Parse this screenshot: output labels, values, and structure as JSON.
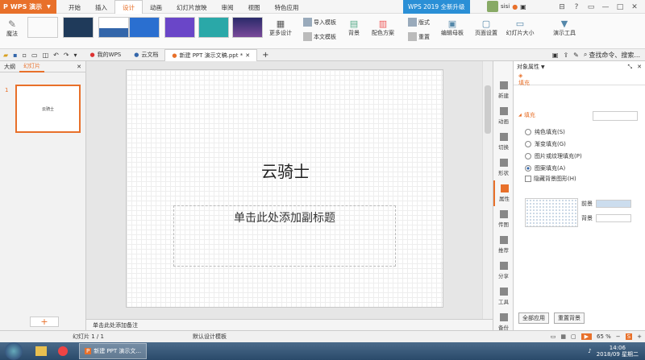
{
  "app": {
    "name": "WPS 演示",
    "upgrade": "WPS 2019 全新升级",
    "user": "sisi"
  },
  "menu_tabs": [
    "开始",
    "插入",
    "设计",
    "动画",
    "幻灯片放映",
    "审阅",
    "视图",
    "特色应用"
  ],
  "active_menu": "设计",
  "ribbon": {
    "magic": "魔法",
    "more_design": "更多设计",
    "import_template": "导入模板",
    "this_template": "本文模板",
    "background": "背景",
    "color_scheme": "配色方案",
    "layout": "版式",
    "rearrange": "重置",
    "edit_master": "编辑母板",
    "page_setup": "页面设置",
    "slide_size": "幻灯片大小",
    "presenter_tools": "演示工具"
  },
  "search_placeholder": "查找命令、搜索...",
  "doc_tabs": [
    {
      "label": "我的WPS",
      "active": false
    },
    {
      "label": "云文档",
      "active": false
    },
    {
      "label": "新建 PPT 演示文稿.ppt *",
      "active": true
    }
  ],
  "left_tabs": {
    "outline": "大纲",
    "slides": "幻灯片"
  },
  "slide": {
    "number": "1",
    "thumb_title": "云骑士",
    "title": "云骑士",
    "subtitle": "单击此处添加副标题"
  },
  "notes_placeholder": "单击此处添加备注",
  "sidebar_items": [
    "新建",
    "动画",
    "切换",
    "形状",
    "属性",
    "传图",
    "推荐",
    "分享",
    "工具",
    "备份"
  ],
  "panel": {
    "title": "对象属性",
    "tab": "填充",
    "section": "填充",
    "options": [
      "纯色填充(S)",
      "渐变填充(G)",
      "图片或纹理填充(P)",
      "图案填充(A)"
    ],
    "selected_option": 3,
    "hide_bg_label": "隐藏背景图形(H)",
    "foreground": "前景",
    "background": "背景",
    "apply_all": "全部应用",
    "reset_bg": "重置背景"
  },
  "status": {
    "slide_info": "幻灯片 1 / 1",
    "template": "默认设计模板",
    "zoom": "65 %"
  },
  "taskbar": {
    "window": "新建 PPT 演示文...",
    "time": "14:06",
    "date": "2018/09 星期二"
  },
  "colors": {
    "accent": "#e8702a",
    "upgrade": "#2a8fd6"
  }
}
